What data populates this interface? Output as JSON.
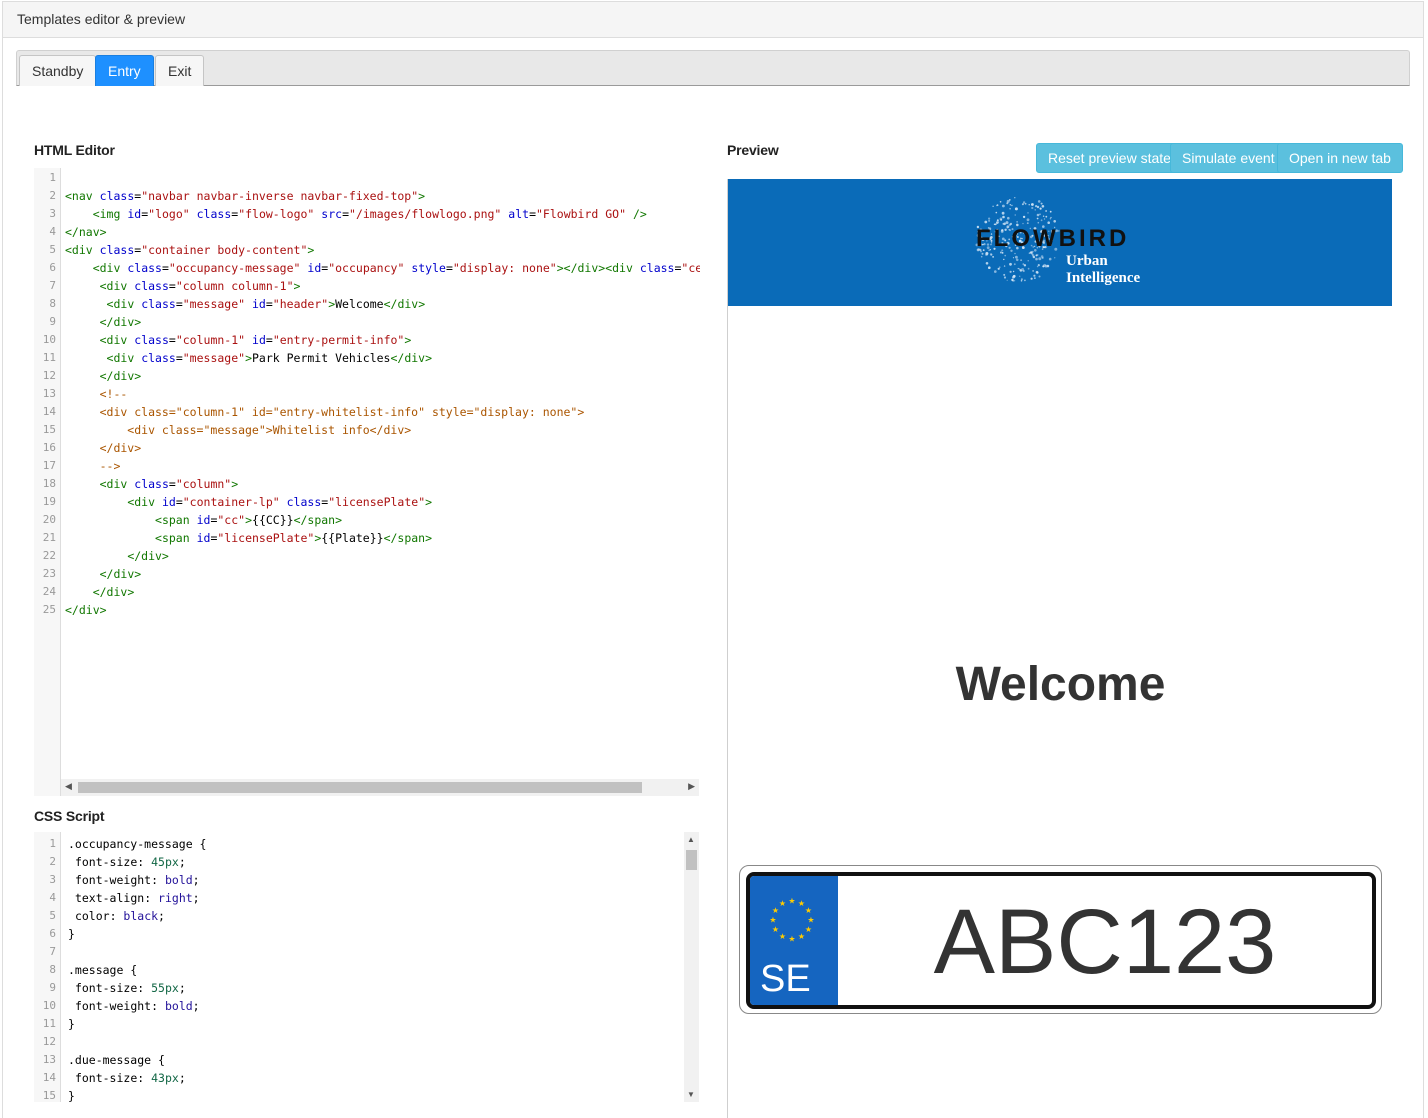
{
  "panel": {
    "title": "Templates editor & preview"
  },
  "tabs": [
    {
      "label": "Standby",
      "active": false
    },
    {
      "label": "Entry",
      "active": true
    },
    {
      "label": "Exit",
      "active": false
    }
  ],
  "html_editor": {
    "label": "HTML Editor",
    "line_numbers": [
      "1",
      "2",
      "3",
      "4",
      "5",
      "6",
      "7",
      "8",
      "9",
      "10",
      "11",
      "12",
      "13",
      "14",
      "15",
      "16",
      "17",
      "18",
      "19",
      "20",
      "21",
      "22",
      "23",
      "24",
      "25"
    ]
  },
  "css_editor": {
    "label": "CSS Script",
    "line_numbers": [
      "1",
      "2",
      "3",
      "4",
      "5",
      "6",
      "7",
      "8",
      "9",
      "10",
      "11",
      "12",
      "13",
      "14",
      "15"
    ]
  },
  "preview": {
    "label": "Preview",
    "buttons": {
      "reset": "Reset preview state",
      "simulate": "Simulate event",
      "open_tab": "Open in new tab"
    },
    "logo": {
      "brand": "FLOWBIRD",
      "tagline_1": "Urban",
      "tagline_2": "Intelligence"
    },
    "welcome_message": "Welcome",
    "plate": {
      "country_code": "SE",
      "number": "ABC123"
    }
  },
  "colors": {
    "tab_active": "#1e90ff",
    "button_info": "#5bc0de",
    "brand_bar": "#0a6bb8",
    "plate_band": "#1565c0",
    "eu_stars": "#ffcc00"
  }
}
